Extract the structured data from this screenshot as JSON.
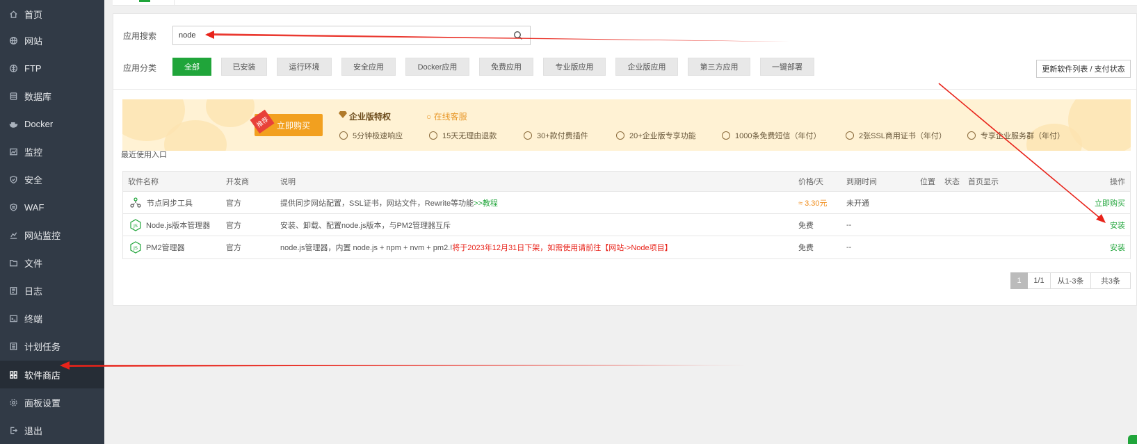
{
  "sidebar": {
    "items": [
      {
        "label": "首页",
        "icon": "home-icon"
      },
      {
        "label": "网站",
        "icon": "globe-icon"
      },
      {
        "label": "FTP",
        "icon": "ftp-icon"
      },
      {
        "label": "数据库",
        "icon": "database-icon"
      },
      {
        "label": "Docker",
        "icon": "docker-icon"
      },
      {
        "label": "监控",
        "icon": "monitor-icon"
      },
      {
        "label": "安全",
        "icon": "shield-icon"
      },
      {
        "label": "WAF",
        "icon": "waf-icon"
      },
      {
        "label": "网站监控",
        "icon": "chart-icon"
      },
      {
        "label": "文件",
        "icon": "folder-icon"
      },
      {
        "label": "日志",
        "icon": "log-icon"
      },
      {
        "label": "终端",
        "icon": "terminal-icon"
      },
      {
        "label": "计划任务",
        "icon": "task-icon"
      },
      {
        "label": "软件商店",
        "icon": "grid-icon",
        "active": true
      },
      {
        "label": "面板设置",
        "icon": "gear-icon"
      },
      {
        "label": "退出",
        "icon": "exit-icon"
      }
    ]
  },
  "search": {
    "label": "应用搜索",
    "value": "node"
  },
  "categories": {
    "label": "应用分类",
    "items": [
      "全部",
      "已安装",
      "运行环境",
      "安全应用",
      "Docker应用",
      "免费应用",
      "专业版应用",
      "企业版应用",
      "第三方应用",
      "一键部署"
    ],
    "active_index": 0
  },
  "refresh_button": "更新软件列表 / 支付状态",
  "banner": {
    "badge": "推荐",
    "buy_button": "立即购买",
    "title": "企业版特权",
    "service": "在线客服",
    "features": [
      "5分钟极速响应",
      "15天无理由退款",
      "30+款付费插件",
      "20+企业版专享功能",
      "1000条免费短信（年付）",
      "2张SSL商用证书（年付）",
      "专享企业服务群（年付）"
    ]
  },
  "recent_label": "最近使用入口",
  "table": {
    "headers": [
      "软件名称",
      "开发商",
      "说明",
      "价格/天",
      "到期时间",
      "位置",
      "状态",
      "首页显示",
      "操作"
    ],
    "rows": [
      {
        "name": "节点同步工具",
        "icon": "sync-node-icon",
        "vendor": "官方",
        "desc": "提供同步网站配置，SSL证书，网站文件，Rewrite等功能",
        "desc_link": ">>教程",
        "desc_warn": "",
        "price": "≈ 3.30元",
        "expiry": "未开通",
        "action": "立即购买"
      },
      {
        "name": "Node.js版本管理器",
        "icon": "nodejs-icon",
        "vendor": "官方",
        "desc": "安装、卸载、配置node.js版本，与PM2管理器互斥",
        "desc_link": "",
        "desc_warn": "",
        "price": "免费",
        "expiry": "--",
        "action": "安装"
      },
      {
        "name": "PM2管理器",
        "icon": "nodejs-icon",
        "vendor": "官方",
        "desc": "node.js管理器，内置 node.js + npm + nvm + pm2.!",
        "desc_link": "",
        "desc_warn": "将于2023年12月31日下架，如需使用请前往【网站->Node项目】",
        "price": "免费",
        "expiry": "--",
        "action": "安装"
      }
    ]
  },
  "pagination": {
    "current": "1",
    "pages": "1/1",
    "range": "从1-3条",
    "total": "共3条"
  },
  "colors": {
    "accent": "#20a53a",
    "sidebar_bg": "#313a46",
    "arrow": "#e8231a",
    "price": "#f08c1a"
  }
}
